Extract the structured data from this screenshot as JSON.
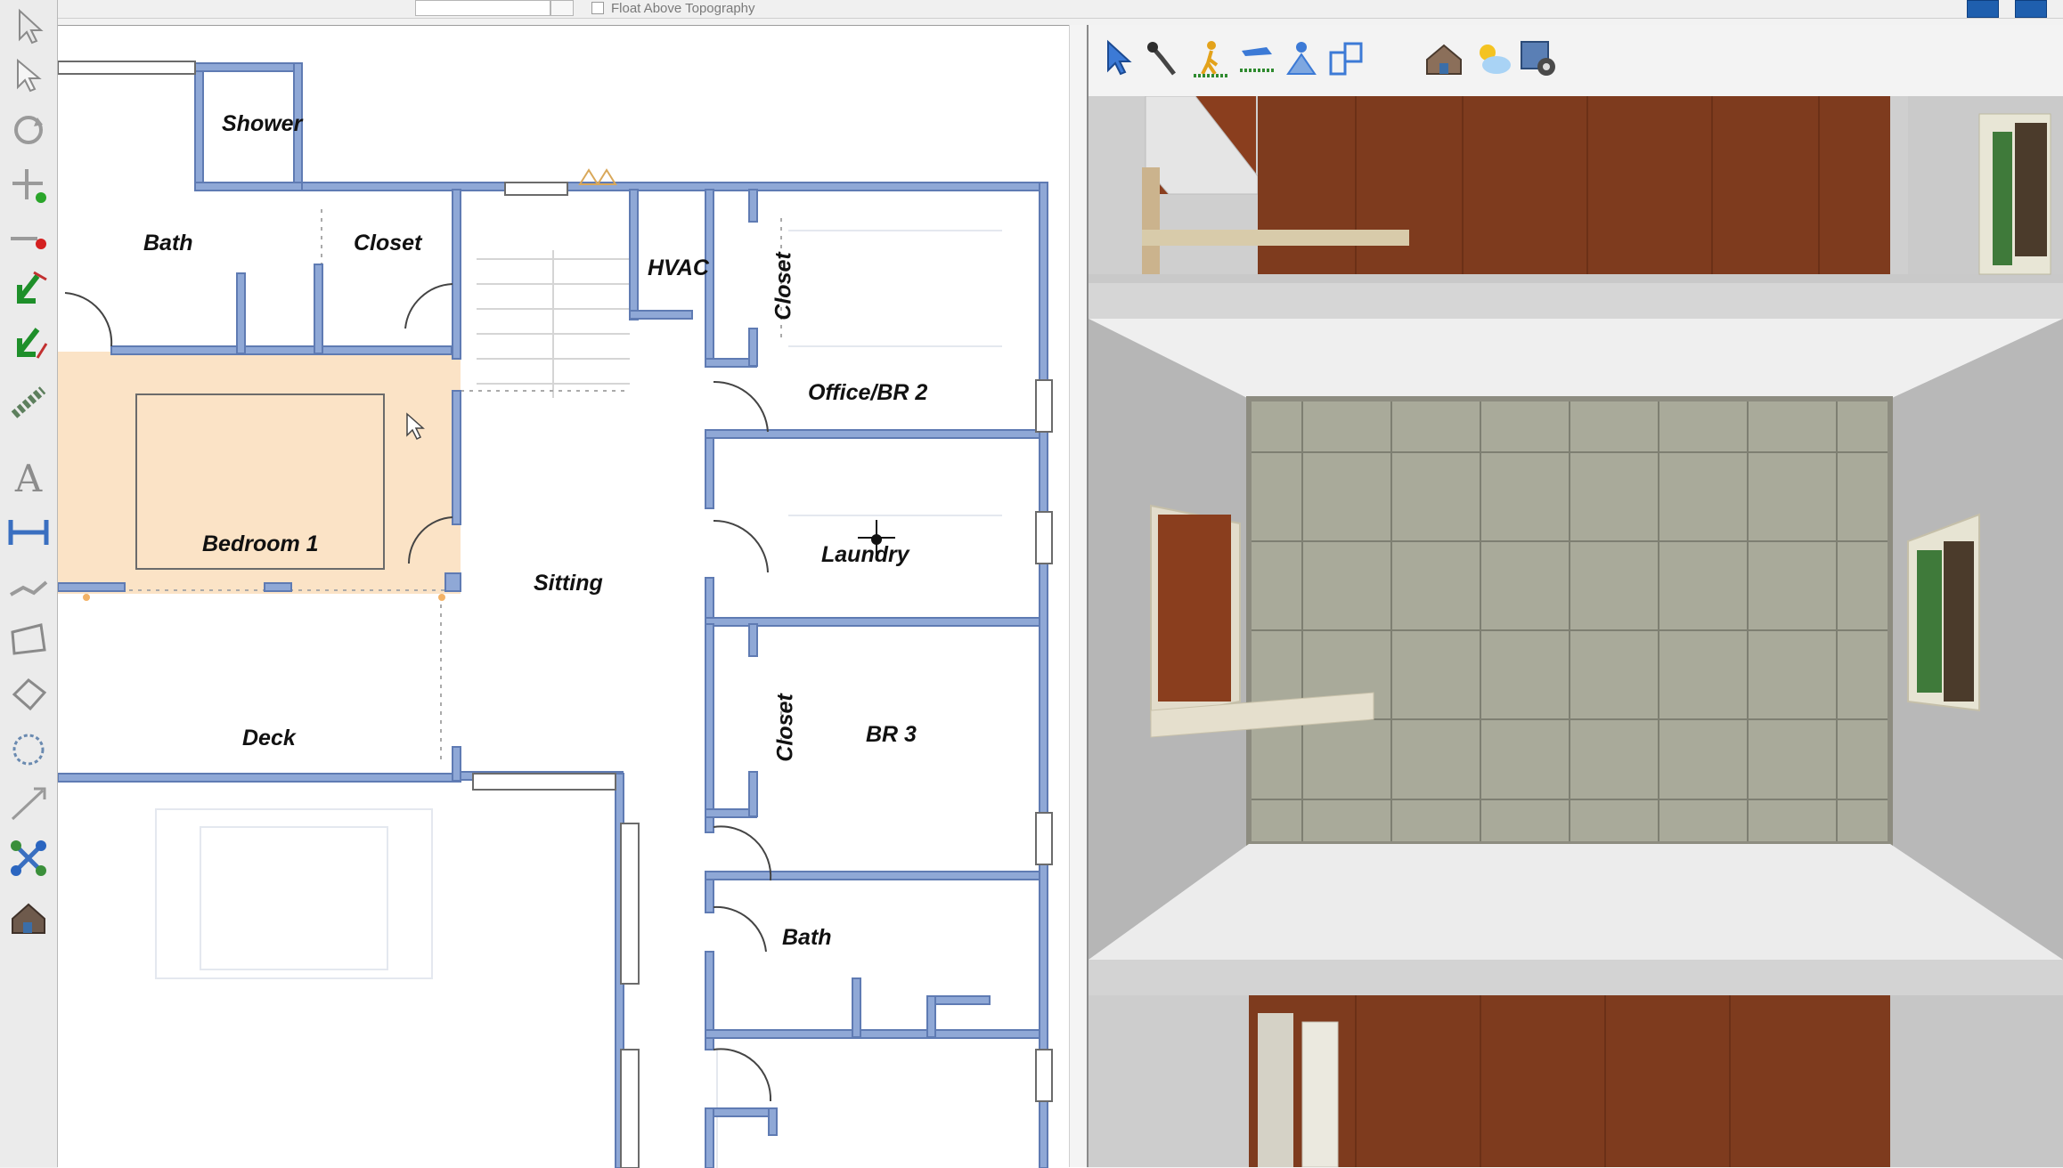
{
  "header": {
    "option_label": "Float Above Topography"
  },
  "colors": {
    "wall": "#8fa8d6",
    "wall_dark": "#5f7bb3",
    "selected_room": "#fbe3c6",
    "floor_wood": "#7a3b1f",
    "tile": "#a9aa9a"
  },
  "left_toolbar": {
    "tools": [
      {
        "name": "select-arrow-icon"
      },
      {
        "name": "select-edit-icon"
      },
      {
        "name": "rotate-icon"
      },
      {
        "name": "add-point-icon"
      },
      {
        "name": "delete-point-icon"
      },
      {
        "name": "move-down-icon"
      },
      {
        "name": "move-up-icon"
      },
      {
        "name": "chain-icon"
      },
      {
        "name": "text-icon"
      },
      {
        "name": "dimension-icon"
      },
      {
        "name": "line-icon"
      },
      {
        "name": "polyline-icon"
      },
      {
        "name": "shape-icon"
      },
      {
        "name": "spline-icon"
      },
      {
        "name": "arrow-icon"
      },
      {
        "name": "connect-icon"
      },
      {
        "name": "house-icon"
      }
    ]
  },
  "floor_plan": {
    "rooms": {
      "shower": "Shower",
      "bath_1": "Bath",
      "closet_1": "Closet",
      "hvac": "HVAC",
      "closet_2": "Closet",
      "office": "Office/BR 2",
      "bedroom_1": "Bedroom 1",
      "laundry": "Laundry",
      "sitting": "Sitting",
      "closet_3": "Closet",
      "br3": "BR 3",
      "deck": "Deck",
      "bath_2": "Bath"
    }
  },
  "view_toolbar": {
    "buttons": [
      {
        "name": "select-view-icon"
      },
      {
        "name": "eyedropper-icon"
      },
      {
        "name": "walkthrough-icon"
      },
      {
        "name": "fly-icon"
      },
      {
        "name": "sun-person-icon"
      },
      {
        "name": "floorplan-icon"
      },
      {
        "name": "exterior-house-icon"
      },
      {
        "name": "sun-cloud-icon"
      },
      {
        "name": "render-settings-icon"
      }
    ]
  }
}
